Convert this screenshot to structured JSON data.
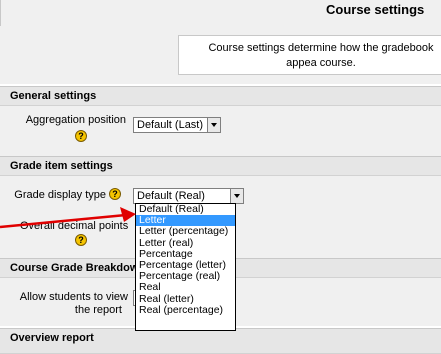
{
  "header": {
    "title": "Course settings",
    "description": "Course settings determine how the gradebook appea course."
  },
  "general": {
    "heading": "General settings",
    "aggregation_label": "Aggregation position",
    "aggregation_value": "Default (Last)"
  },
  "grade_item": {
    "heading": "Grade item settings",
    "display_type_label": "Grade display type",
    "display_type_value": "Default (Real)",
    "decimal_label": "Overall decimal points",
    "options": [
      "Default (Real)",
      "Letter",
      "Letter (percentage)",
      "Letter (real)",
      "Percentage",
      "Percentage (letter)",
      "Percentage (real)",
      "Real",
      "Real (letter)",
      "Real (percentage)"
    ],
    "selected_option": "Letter"
  },
  "breakdown": {
    "heading": "Course Grade Breakdown",
    "allow_label_1": "Allow students to view",
    "allow_label_2": "the report"
  },
  "overview": {
    "heading": "Overview report"
  },
  "icons": {
    "help": "?"
  },
  "colors": {
    "highlight": "#3399ff",
    "arrow": "#e00000",
    "help_icon": "#f5c400"
  }
}
